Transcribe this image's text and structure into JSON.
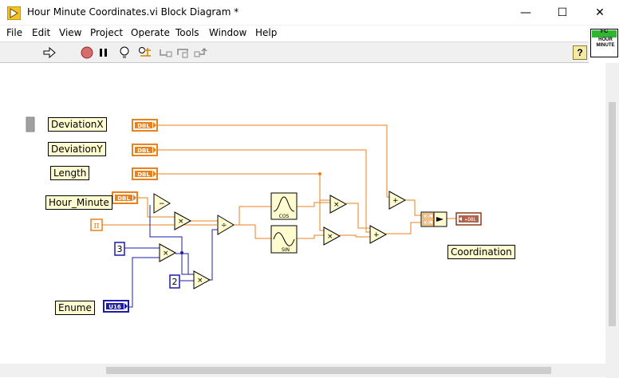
{
  "window": {
    "title": "Hour Minute Coordinates.vi Block Diagram *",
    "minimize": "—",
    "maximize": "☐",
    "close": "✕"
  },
  "menu": [
    "File",
    "Edit",
    "View",
    "Project",
    "Operate",
    "Tools",
    "Window",
    "Help"
  ],
  "toolbar": {
    "icons": [
      "run-arrow-icon",
      "abort-icon",
      "pause-icon",
      "highlight-execution-icon",
      "retain-wire-values-icon",
      "step-into-icon",
      "step-over-icon",
      "step-out-icon"
    ],
    "help": "?"
  },
  "vi_icon": {
    "top": "FC",
    "line1": "HOUR",
    "line2": "MINUTE"
  },
  "labels": {
    "deviationx": "DeviationX",
    "deviationy": "DeviationY",
    "length": "Length",
    "hour_minute": "Hour_Minute",
    "enume": "Enume",
    "coordination": "Coordination"
  },
  "terminals": {
    "dbl": "DBL",
    "u16": "U16",
    "pi": "π",
    "const3": "3",
    "const2": "2",
    "cos": "COS",
    "sin": "SIN"
  },
  "colors": {
    "float_wire": "#e8821e",
    "int_wire": "#1c1ca8",
    "node_fill": "#fffdd0"
  }
}
